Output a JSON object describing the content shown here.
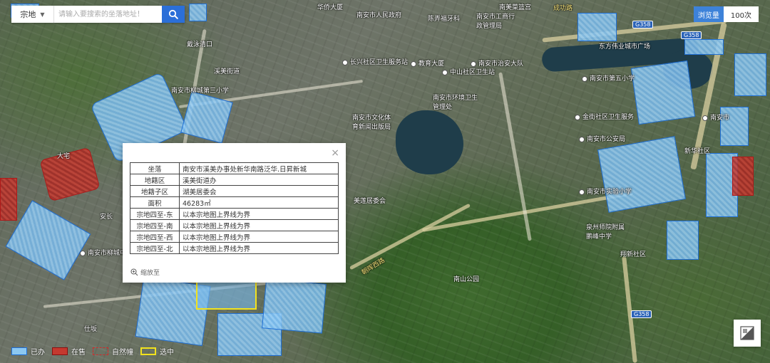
{
  "search": {
    "scope": "宗地",
    "placeholder": "请输入要搜索的坐落地址！"
  },
  "browse": {
    "label": "浏览量",
    "count": "100次"
  },
  "popup": {
    "rows": [
      {
        "key": "坐落",
        "value": "南安市溪美办事处新华南路泛华.日昇新城"
      },
      {
        "key": "地籍区",
        "value": "溪美街道办"
      },
      {
        "key": "地籍子区",
        "value": "湖美居委会"
      },
      {
        "key": "面积",
        "value": "46283㎡"
      },
      {
        "key": "宗地四至-东",
        "value": "以本宗地图上界线为界"
      },
      {
        "key": "宗地四至-南",
        "value": "以本宗地图上界线为界"
      },
      {
        "key": "宗地四至-西",
        "value": "以本宗地图上界线为界"
      },
      {
        "key": "宗地四至-北",
        "value": "以本宗地图上界线为界"
      }
    ],
    "zoom_label": "缩放至",
    "close_glyph": "×"
  },
  "legend": {
    "items": [
      {
        "label": "已办"
      },
      {
        "label": "在售"
      },
      {
        "label": "自然幢"
      },
      {
        "label": "选中"
      }
    ]
  },
  "map_labels": {
    "l1": "南安市人民政府",
    "l2": "南安市工商行政管理局",
    "l3": "陈弄福牙科",
    "l4": "南美菜篮宫",
    "l5": "成功路",
    "l6": "东方伟业城市广场",
    "l7": "教育大厦",
    "l8": "中山社区卫生站",
    "l9": "南安市治安大队",
    "l10": "长兴社区卫生服务站",
    "l11": "南安市环境卫生管理处",
    "l12": "南安市文化体育新闻出版局",
    "l13": "南安市公安局",
    "l14": "南安市第五小学",
    "l15": "金街社区卫生服务",
    "l16": "新华社区",
    "l17": "泉州师院附属鹏峰中学",
    "l18": "南山公园",
    "l19": "朝晖西路",
    "l20": "南安市柳城中学",
    "l21": "南安市柳城第三小学",
    "l22": "大宅",
    "l23": "安长",
    "l24": "仕坂",
    "l25": "戴泳清口",
    "l26": "溪美街道",
    "l27": "华侨大厦",
    "l28": "美莲居委会",
    "l29": "南安市",
    "l30": "南安市实验小学",
    "l31": "翔新社区",
    "g1": "G358",
    "g2": "G358",
    "g3": "G358"
  }
}
